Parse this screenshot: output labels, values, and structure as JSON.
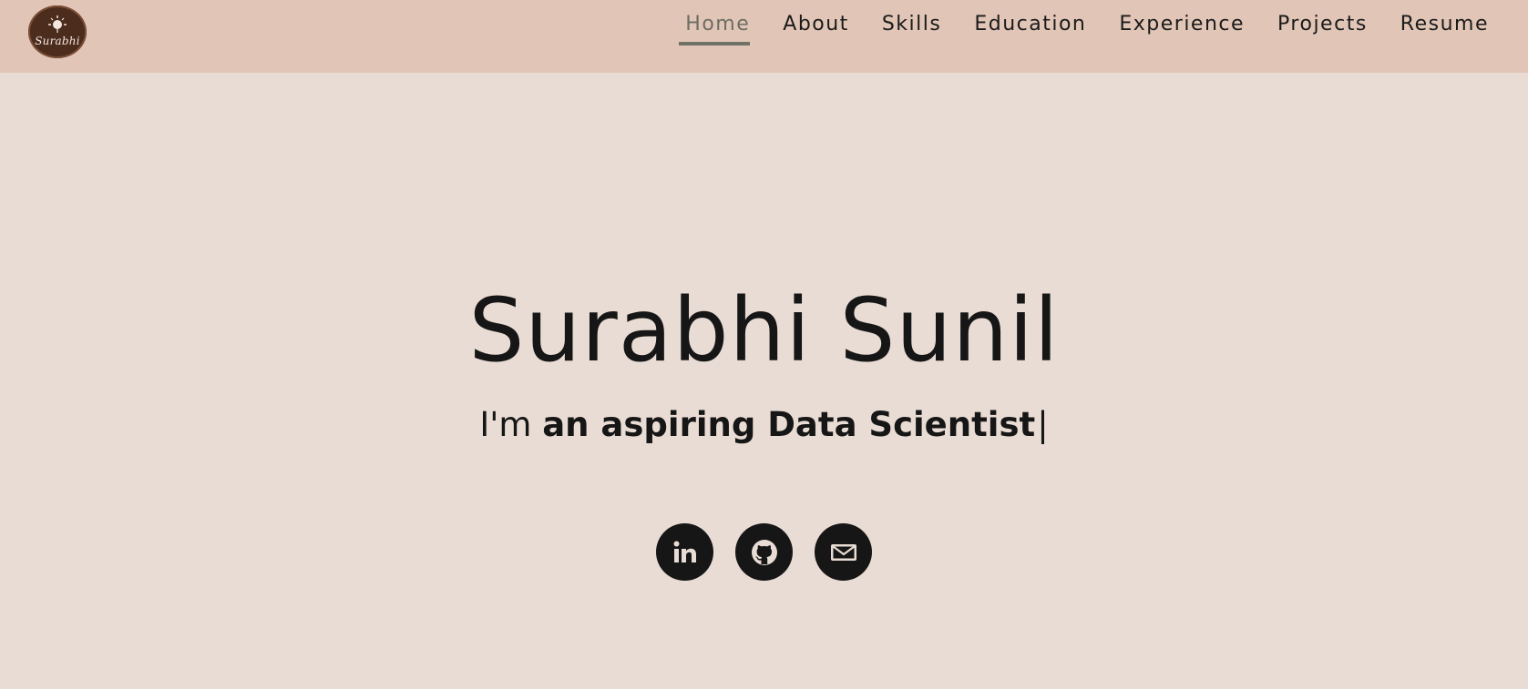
{
  "logo": {
    "text": "Surabhi"
  },
  "nav": {
    "items": [
      {
        "label": "Home",
        "active": true
      },
      {
        "label": "About"
      },
      {
        "label": "Skills"
      },
      {
        "label": "Education"
      },
      {
        "label": "Experience"
      },
      {
        "label": "Projects"
      },
      {
        "label": "Resume"
      }
    ]
  },
  "hero": {
    "name": "Surabhi Sunil",
    "tagline_prefix": "I'm ",
    "tagline_role": "an aspiring Data Scientist",
    "cursor": "|"
  },
  "socials": [
    {
      "icon": "linkedin-icon"
    },
    {
      "icon": "github-icon"
    },
    {
      "icon": "mail-icon"
    }
  ],
  "colors": {
    "page_bg": "#e9dcd4",
    "nav_bg": "#e1c5b6",
    "text": "#161616",
    "active_nav": "#6d6d64",
    "logo_bg": "#4b2c1d"
  }
}
